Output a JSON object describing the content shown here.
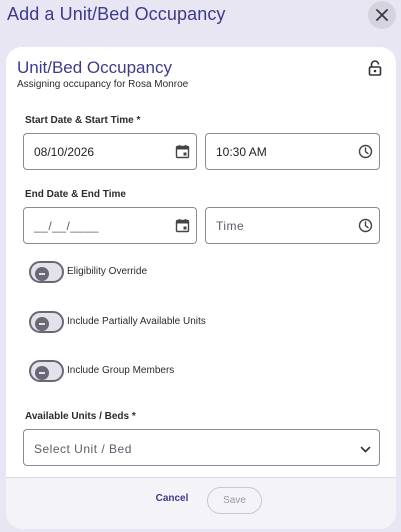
{
  "dialog": {
    "title": "Add a Unit/Bed Occupancy",
    "close_icon": "close-icon"
  },
  "card": {
    "title": "Unit/Bed Occupancy",
    "subtitle": "Assigning occupancy for Rosa Monroe",
    "lock_icon": "lock-open-icon"
  },
  "start": {
    "label": "Start Date & Start Time *",
    "date_value": "08/10/2026",
    "time_value": "10:30 AM"
  },
  "end": {
    "label": "End Date & End Time",
    "date_placeholder": "__/__/____",
    "time_placeholder": "Time"
  },
  "toggles": [
    {
      "label": "Eligibility Override",
      "checked": false
    },
    {
      "label": "Include Partially Available Units",
      "checked": false
    },
    {
      "label": "Include Group Members",
      "checked": false
    }
  ],
  "units": {
    "label": "Available Units / Beds *",
    "placeholder": "Select Unit / Bed"
  },
  "footer": {
    "cancel_label": "Cancel",
    "save_label": "Save"
  },
  "colors": {
    "accent": "#3e3a8c",
    "background": "#e9e6f3"
  }
}
